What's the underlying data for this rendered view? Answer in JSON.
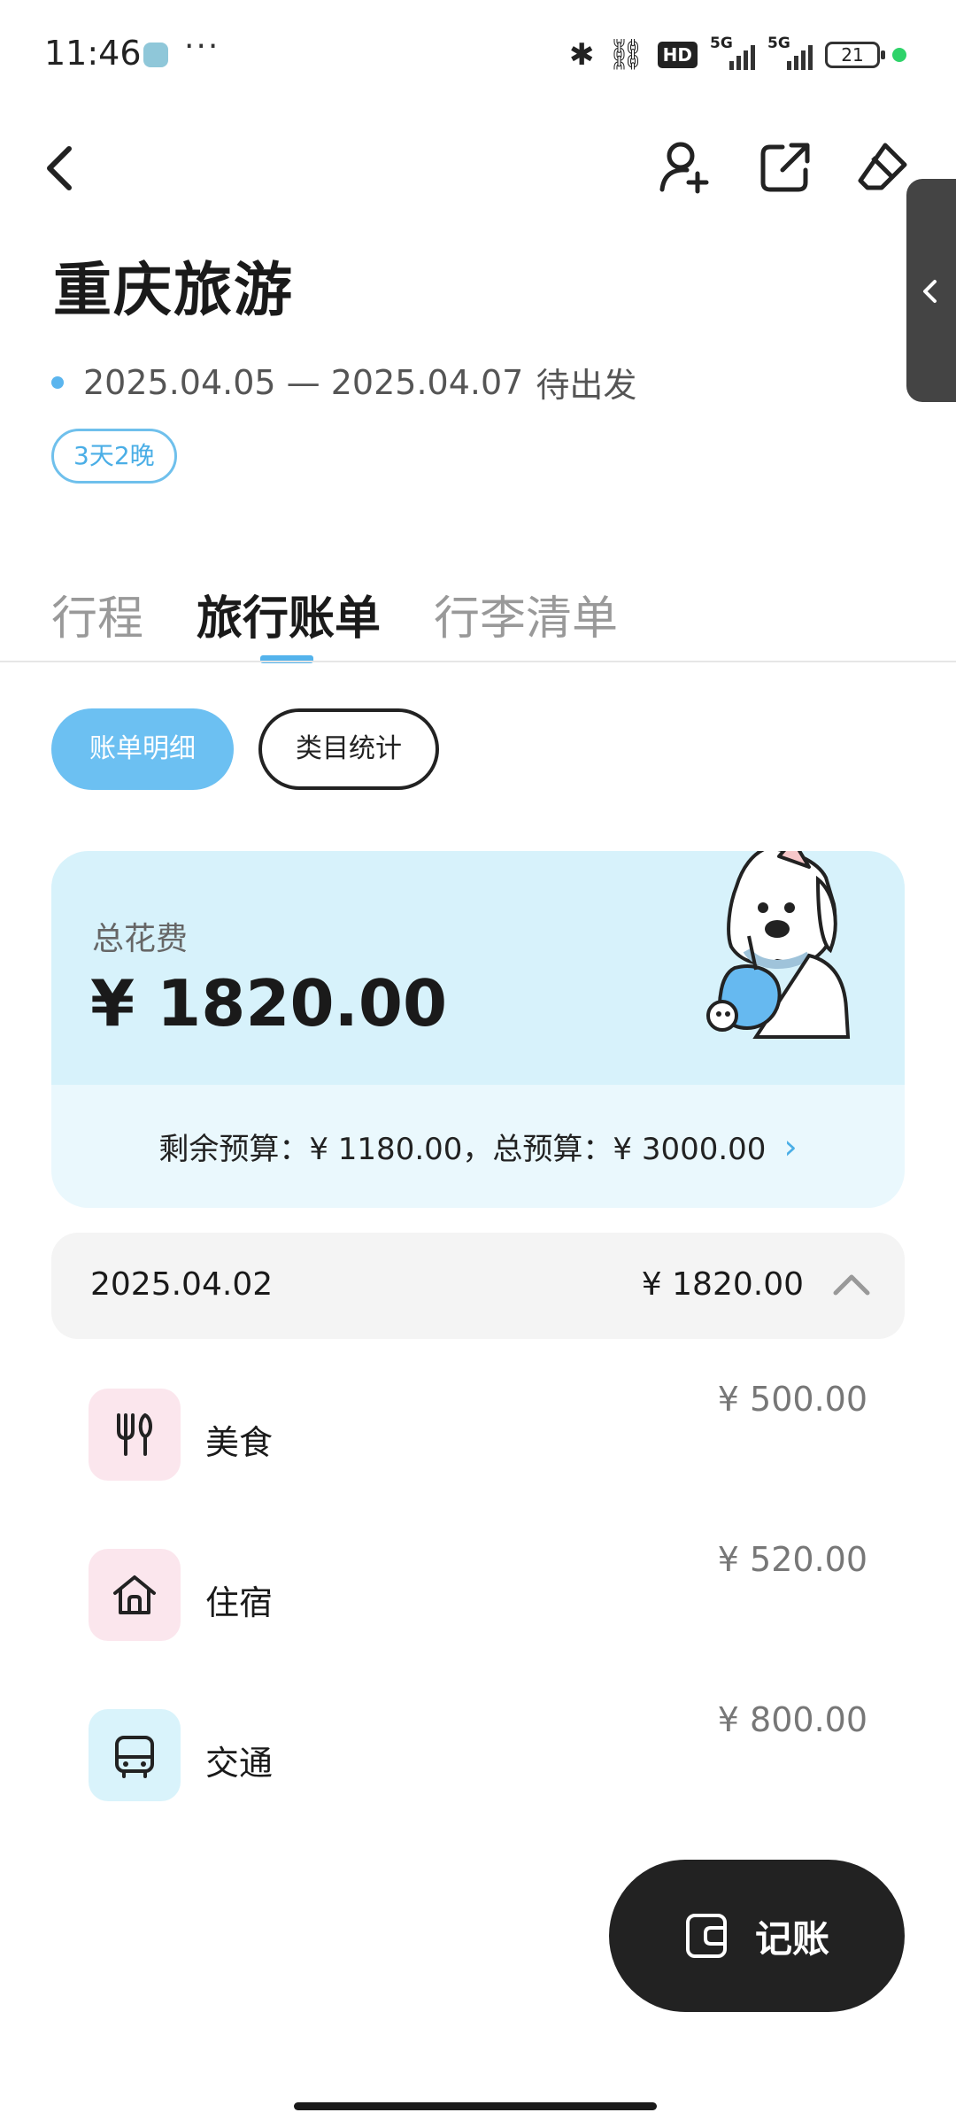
{
  "status_bar": {
    "time": "11:46",
    "dots": "···",
    "hd_label": "HD",
    "network_1": "5G",
    "network_2": "5G",
    "battery": "21"
  },
  "header": {
    "back_icon": "chevron-left-icon",
    "add_member_icon": "user-plus-icon",
    "share_icon": "share-out-icon",
    "edit_icon": "eraser-icon"
  },
  "trip": {
    "title": "重庆旅游",
    "date_range": "2025.04.05 — 2025.04.07",
    "status": "待出发",
    "duration": "3天2晚"
  },
  "tabs": [
    {
      "label": "行程",
      "active": false
    },
    {
      "label": "旅行账单",
      "active": true
    },
    {
      "label": "行李清单",
      "active": false
    }
  ],
  "segments": {
    "detail": "账单明细",
    "category": "类目统计"
  },
  "summary": {
    "total_label": "总花费",
    "total_amount": "¥ 1820.00",
    "budget_text": "剩余预算：¥ 1180.00，总预算：¥ 3000.00"
  },
  "day_group": {
    "date": "2025.04.02",
    "amount": "¥ 1820.00"
  },
  "expenses": [
    {
      "name": "美食",
      "amount": "¥ 500.00",
      "icon": "utensils-icon"
    },
    {
      "name": "住宿",
      "amount": "¥ 520.00",
      "icon": "house-icon"
    },
    {
      "name": "交通",
      "amount": "¥ 800.00",
      "icon": "bus-icon"
    }
  ],
  "fab": {
    "label": "记账",
    "icon": "wallet-icon"
  },
  "colors": {
    "accent": "#54b3ec",
    "card_bg": "#d7f2fb",
    "fab_bg": "#222222"
  }
}
